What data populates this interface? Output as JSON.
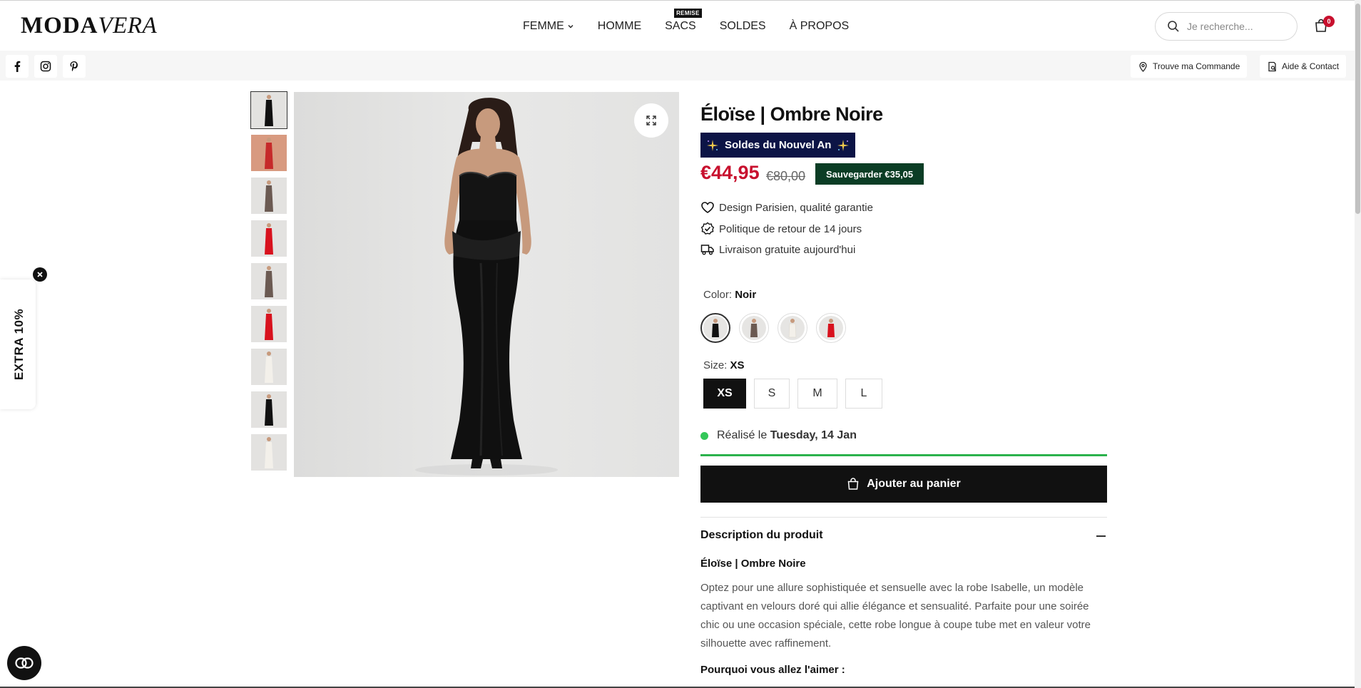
{
  "header": {
    "logo_main": "MODA",
    "logo_italic": "VERA",
    "nav": [
      {
        "label": "FEMME",
        "has_dropdown": true
      },
      {
        "label": "HOMME"
      },
      {
        "label": "SACS",
        "badge": "REMISE"
      },
      {
        "label": "SOLDES"
      },
      {
        "label": "À PROPOS"
      }
    ],
    "search_placeholder": "Je recherche...",
    "cart_count": "0"
  },
  "subbar": {
    "social": [
      "facebook-icon",
      "instagram-icon",
      "pinterest-icon"
    ],
    "track_order": "Trouve ma Commande",
    "help": "Aide & Contact"
  },
  "product": {
    "title": "Éloïse | Ombre Noire",
    "promo_label": "Soldes du Nouvel An",
    "price": "€44,95",
    "old_price": "€80,00",
    "save_label": "Sauvegarder €35,05",
    "features": [
      {
        "icon": "heart-icon",
        "text": "Design Parisien, qualité garantie"
      },
      {
        "icon": "check-badge-icon",
        "text": "Politique de retour de 14 jours"
      },
      {
        "icon": "truck-icon",
        "text": "Livraison gratuite aujourd'hui"
      }
    ],
    "color_label": "Color:",
    "color_value": "Noir",
    "swatches": [
      {
        "name": "swatch-black",
        "dress": "#111111",
        "active": true
      },
      {
        "name": "swatch-brown",
        "dress": "#6b5a52"
      },
      {
        "name": "swatch-white",
        "dress": "#f3f0ea"
      },
      {
        "name": "swatch-red",
        "dress": "#d8121e"
      }
    ],
    "size_label": "Size:",
    "size_value": "XS",
    "sizes": [
      "XS",
      "S",
      "M",
      "L"
    ],
    "delivery_prefix": "Réalisé le",
    "delivery_date": "Tuesday, 14 Jan",
    "add_to_cart": "Ajouter au panier",
    "description_heading": "Description du produit",
    "description_title": "Éloïse | Ombre Noire",
    "description_text": "Optez pour une allure sophistiquée et sensuelle avec la robe Isabelle, un modèle captivant en velours doré qui allie élégance et sensualité. Parfaite pour une soirée chic ou une occasion spéciale, cette robe longue à coupe tube met en valeur votre silhouette avec raffinement.",
    "description_sub": "Pourquoi vous allez l'aimer :"
  },
  "gallery": {
    "thumb_colors": [
      "#111111",
      "#c62a2a",
      "#6b5a52",
      "#d8121e",
      "#6b5a52",
      "#d8121e",
      "#f3f0ea",
      "#111111",
      "#f3f0ea"
    ]
  },
  "widget": {
    "extra_label": "EXTRA 10%"
  }
}
